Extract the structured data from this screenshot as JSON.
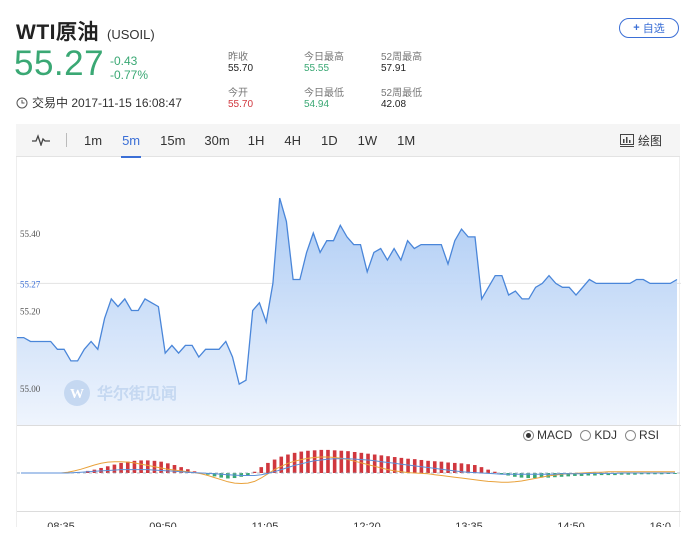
{
  "header": {
    "title": "WTI原油",
    "code": "(USOIL)",
    "watch_label": "自选",
    "watch_plus": "+",
    "price": "55.27",
    "change": "-0.43",
    "change_pct": "-0.77%",
    "status": "交易中 2017-11-15 16:08:47"
  },
  "stats": [
    {
      "label": "昨收",
      "value": "55.70",
      "tone": "black"
    },
    {
      "label": "今日最高",
      "value": "55.55",
      "tone": "green"
    },
    {
      "label": "52周最高",
      "value": "57.91",
      "tone": "black"
    },
    {
      "label": "今开",
      "value": "55.70",
      "tone": "red"
    },
    {
      "label": "今日最低",
      "value": "54.94",
      "tone": "green"
    },
    {
      "label": "52周最低",
      "value": "42.08",
      "tone": "black"
    }
  ],
  "tabs": {
    "items": [
      "1m",
      "5m",
      "15m",
      "30m",
      "1H",
      "4H",
      "1D",
      "1W",
      "1M"
    ],
    "active": "5m",
    "draw_label": "绘图"
  },
  "indicators": {
    "items": [
      "MACD",
      "KDJ",
      "RSI"
    ],
    "selected": "MACD"
  },
  "watermark": "华尔街见闻",
  "colors": {
    "up": "#d0373e",
    "down": "#3aa874",
    "accent": "#3b6fd6",
    "line": "#4a86d9"
  },
  "chart_data": [
    {
      "type": "area",
      "y_ticks": [
        "55.40",
        "55.27",
        "55.20",
        "55.00"
      ],
      "y_tick_values": [
        55.4,
        55.27,
        55.2,
        55.0
      ],
      "current_value": 55.27,
      "ylim": [
        54.92,
        55.56
      ],
      "x_labels": [
        "08:35",
        "09:50",
        "11:05",
        "12:20",
        "13:35",
        "14:50",
        "16:0"
      ],
      "values": [
        55.13,
        55.13,
        55.12,
        55.12,
        55.12,
        55.12,
        55.1,
        55.1,
        55.07,
        55.07,
        55.1,
        55.12,
        55.1,
        55.18,
        55.23,
        55.21,
        55.23,
        55.2,
        55.2,
        55.23,
        55.22,
        55.21,
        55.09,
        55.11,
        55.09,
        55.11,
        55.11,
        55.08,
        55.1,
        55.1,
        55.1,
        55.12,
        55.08,
        55.01,
        55.02,
        55.2,
        55.22,
        55.17,
        55.27,
        55.49,
        55.43,
        55.28,
        55.28,
        55.35,
        55.4,
        55.35,
        55.38,
        55.38,
        55.42,
        55.39,
        55.37,
        55.37,
        55.3,
        55.35,
        55.36,
        55.33,
        55.36,
        55.33,
        55.38,
        55.36,
        55.37,
        55.37,
        55.37,
        55.37,
        55.32,
        55.38,
        55.41,
        55.39,
        55.39,
        55.23,
        55.26,
        55.29,
        55.29,
        55.24,
        55.25,
        55.23,
        55.23,
        55.26,
        55.27,
        55.29,
        55.27,
        55.26,
        55.26,
        55.24,
        55.26,
        55.28,
        55.27,
        55.27,
        55.27,
        55.27,
        55.27,
        55.27,
        55.28,
        55.28,
        55.27,
        55.27,
        55.27,
        55.27,
        55.28
      ]
    },
    {
      "type": "bar",
      "name": "MACD",
      "histogram": [
        0,
        0,
        0,
        0,
        0,
        0,
        0,
        0,
        0,
        0,
        0.5,
        0.8,
        1.2,
        1.6,
        2.0,
        2.4,
        2.7,
        2.9,
        3.0,
        3.0,
        2.9,
        2.7,
        2.3,
        1.9,
        1.4,
        0.9,
        0.4,
        0,
        -0.4,
        -0.8,
        -1.1,
        -1.3,
        -1.2,
        -0.9,
        -0.5,
        0.3,
        1.4,
        2.4,
        3.2,
        3.9,
        4.4,
        4.8,
        5.1,
        5.3,
        5.4,
        5.5,
        5.5,
        5.4,
        5.3,
        5.2,
        5.0,
        4.8,
        4.6,
        4.4,
        4.2,
        4.0,
        3.8,
        3.6,
        3.4,
        3.3,
        3.1,
        2.9,
        2.8,
        2.7,
        2.5,
        2.4,
        2.3,
        2.1,
        1.9,
        1.4,
        0.8,
        0.3,
        -0.2,
        -0.6,
        -0.9,
        -1.1,
        -1.2,
        -1.2,
        -1.1,
        -1.1,
        -1.0,
        -0.9,
        -0.8,
        -0.7,
        -0.7,
        -0.6,
        -0.6,
        -0.5,
        -0.5,
        -0.5,
        -0.4,
        -0.4,
        -0.4,
        -0.3,
        -0.3,
        -0.3,
        -0.3,
        -0.2,
        -0.2
      ],
      "dif": [
        0,
        0,
        0,
        0,
        0,
        0,
        0,
        0.2,
        0.5,
        0.9,
        1.4,
        1.9,
        2.3,
        2.6,
        2.7,
        2.7,
        2.6,
        2.4,
        2.1,
        1.8,
        1.5,
        1.2,
        0.9,
        0.7,
        0.5,
        0.3,
        0.1,
        -0.2,
        -0.6,
        -1.1,
        -1.6,
        -2.1,
        -2.4,
        -2.5,
        -2.4,
        -2.0,
        -1.2,
        -0.2,
        0.8,
        1.6,
        2.3,
        2.8,
        3.2,
        3.5,
        3.7,
        3.8,
        3.8,
        3.7,
        3.5,
        3.2,
        2.8,
        2.4,
        2.0,
        1.6,
        1.2,
        0.8,
        0.5,
        0.3,
        0.1,
        0,
        -0.1,
        -0.2,
        -0.4,
        -0.6,
        -0.8,
        -1.0,
        -1.2,
        -1.4,
        -1.6,
        -1.8,
        -2.0,
        -2.1,
        -2.2,
        -2.2,
        -2.1,
        -1.9,
        -1.6,
        -1.3,
        -1.0,
        -0.7,
        -0.5,
        -0.3,
        -0.2,
        -0.1,
        0,
        0.1,
        0.2,
        0.2,
        0.3,
        0.3,
        0.3,
        0.3,
        0.3,
        0.3,
        0.3,
        0.3,
        0.3,
        0.3,
        0.3
      ],
      "dea": [
        0,
        0,
        0,
        0,
        0,
        0,
        0,
        0,
        0.1,
        0.2,
        0.3,
        0.4,
        0.5,
        0.6,
        0.7,
        0.8,
        0.8,
        0.8,
        0.8,
        0.8,
        0.7,
        0.6,
        0.5,
        0.4,
        0.3,
        0.2,
        0.1,
        0,
        -0.1,
        -0.2,
        -0.3,
        -0.4,
        -0.5,
        -0.6,
        -0.6,
        -0.6,
        -0.4,
        -0.1,
        0.3,
        0.8,
        1.3,
        1.8,
        2.2,
        2.6,
        2.9,
        3.1,
        3.3,
        3.4,
        3.4,
        3.4,
        3.3,
        3.2,
        3.1,
        2.9,
        2.7,
        2.5,
        2.3,
        2.1,
        1.9,
        1.7,
        1.5,
        1.3,
        1.1,
        0.9,
        0.7,
        0.5,
        0.3,
        0.2,
        0.1,
        0,
        -0.1,
        -0.2,
        -0.3,
        -0.3,
        -0.3,
        -0.3,
        -0.3,
        -0.3,
        -0.3,
        -0.3,
        -0.3,
        -0.2,
        -0.2,
        -0.2,
        -0.2,
        -0.1,
        -0.1,
        -0.1,
        -0.1,
        -0.1,
        0,
        0,
        0,
        0,
        0,
        0,
        0,
        0,
        0
      ]
    }
  ]
}
